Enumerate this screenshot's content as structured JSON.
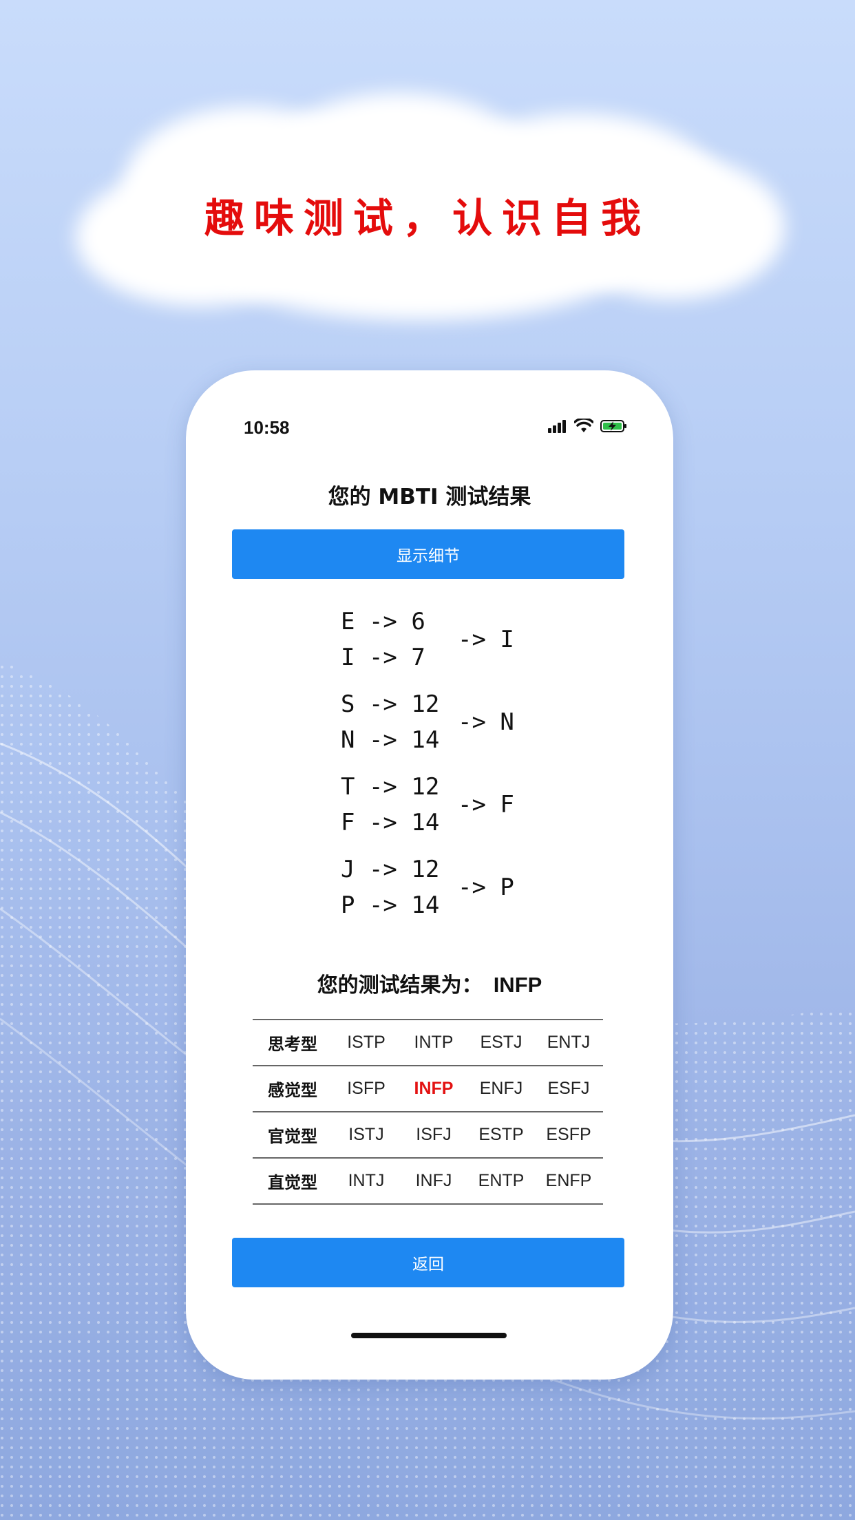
{
  "promo": {
    "headline": "趣味测试，认识自我"
  },
  "status_bar": {
    "time": "10:58",
    "icons": [
      "cellular-signal-icon",
      "wifi-icon",
      "battery-charging-icon"
    ]
  },
  "screen": {
    "title": "您的 MBTI 测试结果",
    "details_button": "显示细节",
    "back_button": "返回"
  },
  "scores": [
    {
      "line1": "E -> 6",
      "line2": "I -> 7",
      "winner": "-> I"
    },
    {
      "line1": "S -> 12",
      "line2": "N -> 14",
      "winner": "-> N"
    },
    {
      "line1": "T -> 12",
      "line2": "F -> 14",
      "winner": "-> F"
    },
    {
      "line1": "J -> 12",
      "line2": "P -> 14",
      "winner": "-> P"
    }
  ],
  "result": {
    "label": "您的测试结果为：",
    "value": "INFP"
  },
  "table": {
    "rows": [
      {
        "category": "思考型",
        "types": [
          "ISTP",
          "INTP",
          "ESTJ",
          "ENTJ"
        ]
      },
      {
        "category": "感觉型",
        "types": [
          "ISFP",
          "INFP",
          "ENFJ",
          "ESFJ"
        ]
      },
      {
        "category": "官觉型",
        "types": [
          "ISTJ",
          "ISFJ",
          "ESTP",
          "ESFP"
        ]
      },
      {
        "category": "直觉型",
        "types": [
          "INTJ",
          "INFJ",
          "ENTP",
          "ENFP"
        ]
      }
    ],
    "highlight": "INFP",
    "highlight_color": "#e31212"
  },
  "colors": {
    "accent": "#1e88f2",
    "headline": "#e40c0c"
  }
}
